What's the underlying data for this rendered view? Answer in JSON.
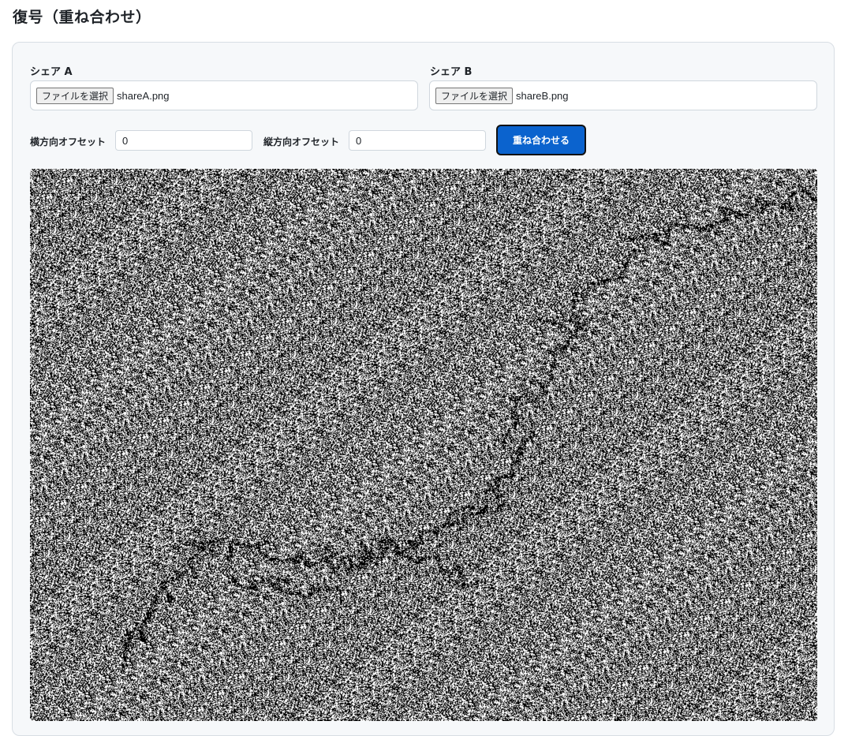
{
  "page": {
    "title": "復号（重ね合わせ）"
  },
  "share_a": {
    "label": "シェア A",
    "button_label": "ファイルを選択",
    "file_name": "shareA.png"
  },
  "share_b": {
    "label": "シェア B",
    "button_label": "ファイルを選択",
    "file_name": "shareB.png"
  },
  "offsets": {
    "horizontal_label": "横方向オフセット",
    "horizontal_value": "0",
    "vertical_label": "縦方向オフセット",
    "vertical_value": "0"
  },
  "actions": {
    "overlay_label": "重ね合わせる"
  },
  "result": {
    "image_description_icon": "visual-cryptography-noise-image"
  },
  "colors": {
    "accent": "#0b63ce",
    "panel_background": "#f6f8fa"
  }
}
